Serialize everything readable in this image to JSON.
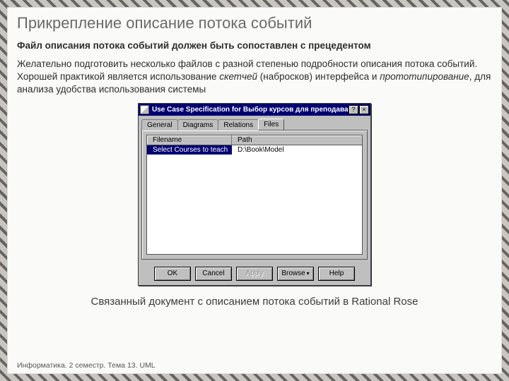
{
  "title": "Прикрепление описание потока событий",
  "lead": "Файл описания потока событий должен быть сопоставлен с прецедентом",
  "body_parts": {
    "p1": "Желательно подготовить несколько файлов с разной степенью подробности описания потока событий. Хорошей практикой является использование ",
    "em1": "скетчей",
    "p2": " (набросков) интерфейса и ",
    "em2": "прототипирование",
    "p3": ", для анализа удобства использования системы"
  },
  "dialog": {
    "caption": "Use Case Specification for Выбор курсов для преподавания",
    "close": "×",
    "help": "?",
    "tabs": {
      "general": "General",
      "diagrams": "Diagrams",
      "relations": "Relations",
      "files": "Files"
    },
    "columns": {
      "filename": "Filename",
      "path": "Path"
    },
    "row": {
      "filename": "Select Courses to teach",
      "path": "D:\\Book\\Model"
    },
    "buttons": {
      "ok": "OK",
      "cancel": "Cancel",
      "apply": "Apply",
      "browse": "Browse",
      "help": "Help"
    }
  },
  "figure_caption": "Связанный документ с описанием потока событий в Rational Rose",
  "footer": "Информатика. 2 семестр. Тема 13. UML"
}
